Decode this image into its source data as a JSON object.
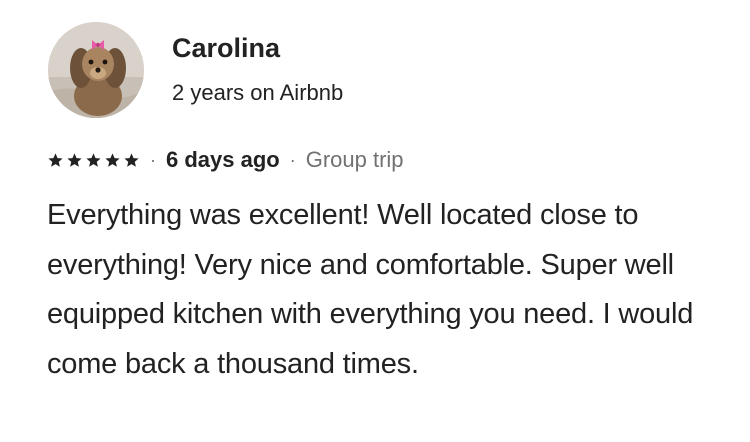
{
  "reviewer": {
    "name": "Carolina",
    "tenure": "2 years on Airbnb",
    "avatar_icon": "dog-photo-avatar"
  },
  "rating": {
    "stars": 5,
    "max": 5,
    "star_icon": "star-icon"
  },
  "meta": {
    "separator": "·",
    "date": "6 days ago",
    "trip_type": "Group trip"
  },
  "review": {
    "text": "Everything was excellent! Well located close to everything! Very nice and comfortable. Super well equipped kitchen with everything you need. I would come back a thousand times."
  },
  "colors": {
    "text_primary": "#222222",
    "text_secondary": "#717171",
    "background": "#ffffff"
  }
}
